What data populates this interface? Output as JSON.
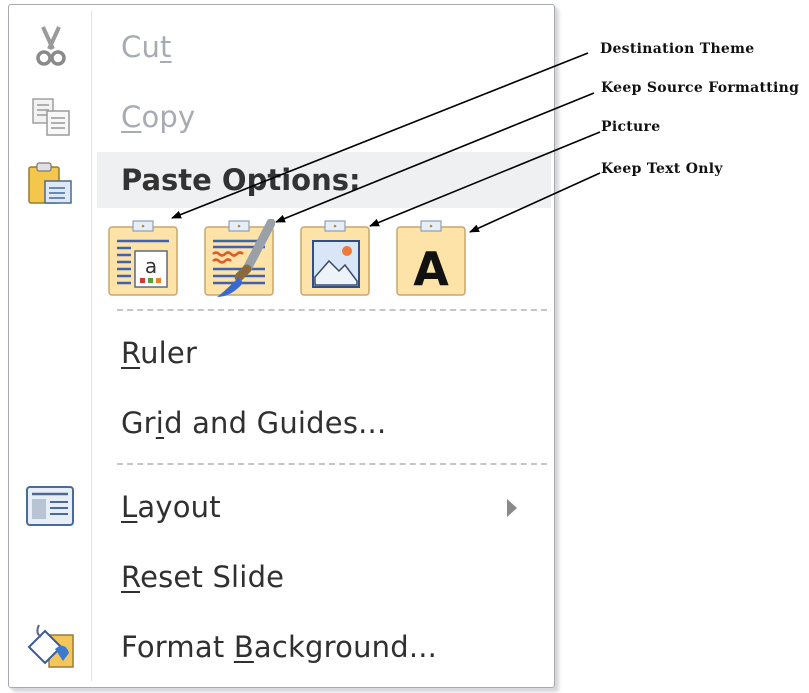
{
  "menu": {
    "items": [
      {
        "label": "Cut",
        "accel_index": 2,
        "icon": "scissors-icon",
        "disabled": true
      },
      {
        "label": "Copy",
        "accel_index": 0,
        "icon": "copy-icon",
        "disabled": true
      }
    ],
    "paste_options": {
      "header": "Paste Options:",
      "icon": "clipboard-paste-icon",
      "buttons": [
        {
          "name": "Destination Theme",
          "icon": "paste-destination-theme-icon"
        },
        {
          "name": "Keep Source Formatting",
          "icon": "paste-keep-source-formatting-icon"
        },
        {
          "name": "Picture",
          "icon": "paste-picture-icon"
        },
        {
          "name": "Keep Text Only",
          "icon": "paste-keep-text-only-icon"
        }
      ]
    },
    "group2": [
      {
        "label_pre": "",
        "accel": "R",
        "label_post": "uler"
      },
      {
        "label_pre": "Gr",
        "accel": "i",
        "label_post": "d and Guides..."
      }
    ],
    "group3": [
      {
        "label_pre": "",
        "accel": "L",
        "label_post": "ayout",
        "icon": "layout-icon",
        "submenu": true
      },
      {
        "label_pre": "",
        "accel": "R",
        "label_post": "eset Slide"
      },
      {
        "label_pre": "Format ",
        "accel": "B",
        "label_post": "ackground...",
        "icon": "paint-bucket-icon"
      }
    ]
  },
  "callouts": [
    "Destination Theme",
    "Keep Source Formatting",
    "Picture",
    "Keep Text Only"
  ],
  "colors": {
    "clipboard_fill": "#fde3a7",
    "clipboard_border": "#c9a66b",
    "disabled_text": "#a7abb3",
    "header_bg": "#eff0f2"
  }
}
